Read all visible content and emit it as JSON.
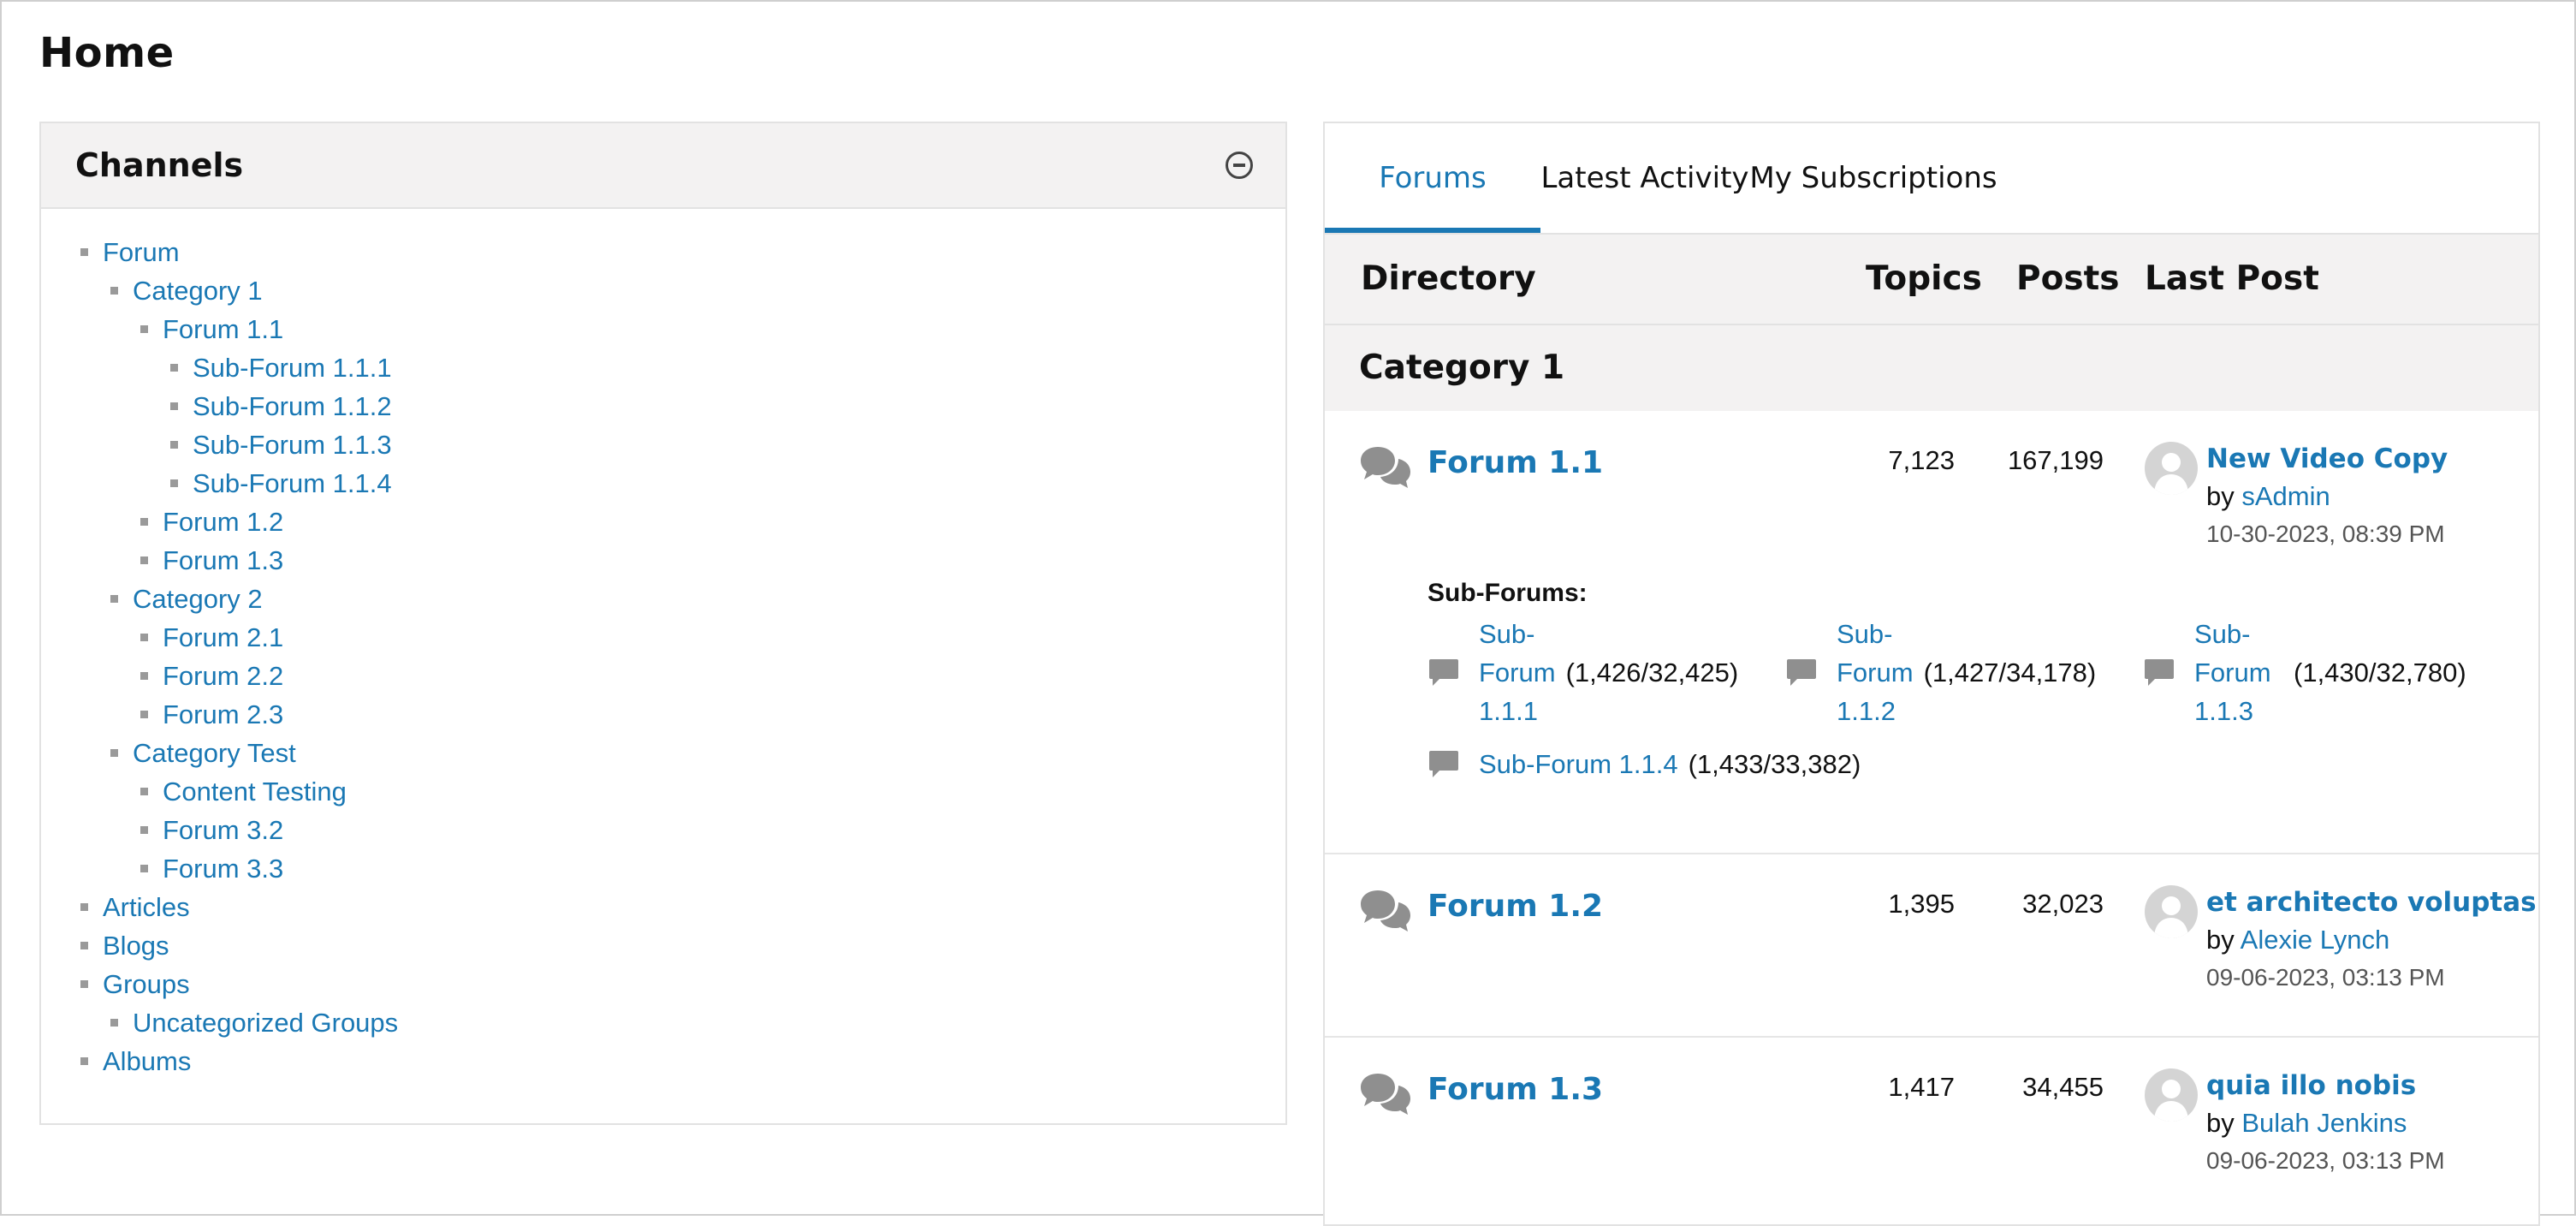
{
  "page": {
    "title": "Home"
  },
  "channels": {
    "title": "Channels",
    "items": [
      {
        "label": "Forum",
        "level": 0
      },
      {
        "label": "Category 1",
        "level": 1
      },
      {
        "label": "Forum 1.1",
        "level": 2
      },
      {
        "label": "Sub-Forum 1.1.1",
        "level": 3
      },
      {
        "label": "Sub-Forum 1.1.2",
        "level": 3
      },
      {
        "label": "Sub-Forum 1.1.3",
        "level": 3
      },
      {
        "label": "Sub-Forum 1.1.4",
        "level": 3
      },
      {
        "label": "Forum 1.2",
        "level": 2
      },
      {
        "label": "Forum 1.3",
        "level": 2
      },
      {
        "label": "Category 2",
        "level": 1
      },
      {
        "label": "Forum 2.1",
        "level": 2
      },
      {
        "label": "Forum 2.2",
        "level": 2
      },
      {
        "label": "Forum 2.3",
        "level": 2
      },
      {
        "label": "Category Test",
        "level": 1
      },
      {
        "label": "Content Testing",
        "level": 2
      },
      {
        "label": "Forum 3.2",
        "level": 2
      },
      {
        "label": "Forum 3.3",
        "level": 2
      },
      {
        "label": "Articles",
        "level": 0
      },
      {
        "label": "Blogs",
        "level": 0
      },
      {
        "label": "Groups",
        "level": 0
      },
      {
        "label": "Uncategorized Groups",
        "level": 1
      },
      {
        "label": "Albums",
        "level": 0
      }
    ]
  },
  "tabs": [
    {
      "label": "Forums",
      "active": true
    },
    {
      "label": "Latest Activity",
      "active": false
    },
    {
      "label": "My Subscriptions",
      "active": false
    }
  ],
  "table": {
    "headers": {
      "directory": "Directory",
      "topics": "Topics",
      "posts": "Posts",
      "last_post": "Last Post"
    },
    "category": "Category 1",
    "subforums_label": "Sub-Forums:",
    "forums": [
      {
        "name": "Forum 1.1",
        "topics": "7,123",
        "posts": "167,199",
        "last_post": {
          "title": "New Video Copy",
          "by": "by",
          "author": "sAdmin",
          "date": "10-30-2023, 08:39 PM"
        },
        "subforums": [
          {
            "line1": "Sub-",
            "line2": "Forum",
            "line3": "1.1.1",
            "count": "(1,426/32,425)"
          },
          {
            "line1": "Sub-",
            "line2": "Forum",
            "line3": "1.1.2",
            "count": "(1,427/34,178)"
          },
          {
            "line1": "Sub-",
            "line2": "Forum",
            "line3": "1.1.3",
            "count": "(1,430/32,780)"
          },
          {
            "name": "Sub-Forum 1.1.4",
            "count": "(1,433/33,382)"
          }
        ]
      },
      {
        "name": "Forum 1.2",
        "topics": "1,395",
        "posts": "32,023",
        "last_post": {
          "title": "et architecto voluptas",
          "by": "by",
          "author": "Alexie Lynch",
          "date": "09-06-2023, 03:13 PM"
        }
      },
      {
        "name": "Forum 1.3",
        "topics": "1,417",
        "posts": "34,455",
        "last_post": {
          "title": "quia illo nobis",
          "by": "by",
          "author": "Bulah Jenkins",
          "date": "09-06-2023, 03:13 PM"
        }
      }
    ]
  },
  "colors": {
    "link": "#1a78b4",
    "header_bg": "#f3f2f2",
    "border": "#e2e2e2",
    "icon_gray": "#8f8f8f"
  },
  "icons": {
    "collapse": "minus-circle-icon",
    "forum": "chat-bubbles-icon",
    "subforum": "speech-bubble-icon",
    "avatar": "default-user-avatar"
  }
}
